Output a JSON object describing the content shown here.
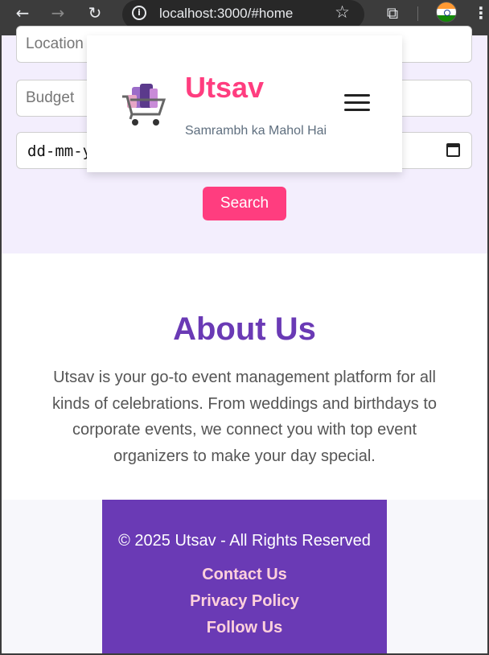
{
  "browser": {
    "back_icon": "arrow-left-icon",
    "forward_icon": "arrow-right-icon",
    "reload_icon": "reload-icon",
    "url": "localhost:3000/#home",
    "info_icon": "info-icon",
    "bookmark_icon": "star-icon",
    "extensions_icon": "puzzle-icon",
    "menu_icon": "kebab-icon"
  },
  "search_form": {
    "location_placeholder": "Location",
    "budget_placeholder": "Budget",
    "date_placeholder": "dd-mm-y",
    "search_label": "Search"
  },
  "header": {
    "brand": "Utsav",
    "tagline": "Samrambh ka Mahol Hai"
  },
  "about": {
    "title": "About Us",
    "body": "Utsav is your go-to event management platform for all kinds of celebrations. From weddings and birthdays to corporate events, we connect you with top event organizers to make your day special."
  },
  "footer": {
    "copyright": "© 2025 Utsav - All Rights Reserved",
    "links": [
      "Contact Us",
      "Privacy Policy",
      "Follow Us"
    ]
  },
  "colors": {
    "accent_pink": "#ff3d7f",
    "accent_purple": "#6a3ab5",
    "form_bg": "#f3eefd",
    "footer_link": "#ffd1dc"
  }
}
